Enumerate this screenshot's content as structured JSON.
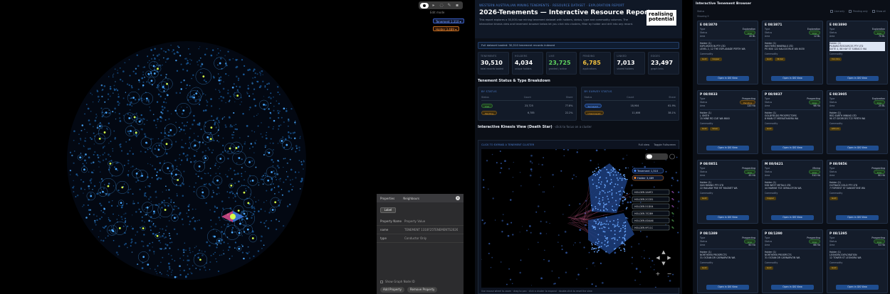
{
  "graph_view": {
    "toolbar_icons": [
      "grab-icon",
      "pointer-icon",
      "lasso-icon",
      "pen-icon",
      "trash-icon"
    ],
    "caption": "Edit mode",
    "tags": [
      "Tenement 1,310 ▾",
      "Holder 3,489 ▾"
    ],
    "properties": {
      "tab1": "Properties",
      "tab2": "Neighbours",
      "label_button": "Label",
      "col_name": "Property Name",
      "col_value": "Property Value",
      "rows": [
        {
          "key": "name",
          "value": "TENEMENT 1310F25TENEMENTS2026"
        },
        {
          "key": "type",
          "value": "Conductor Only"
        }
      ],
      "show_graph_nodes": "Show Graph Node ID",
      "add_property": "Add Property",
      "remove_property": "Remove Property"
    },
    "colors": {
      "node": "#1a5a9a",
      "hub": "#4aa8ff",
      "accent": "#d6ff4a"
    }
  },
  "report": {
    "eyebrow": "WESTERN AUSTRALIAN MINING TENEMENTS · RESOURCE DATASET · EXPLORATION REPORT",
    "title": "2026-Tenements — Interactive Resource Report",
    "description": "This report explores a 30,000-row mining tenement dataset with holders, status, type and commodity columns. The interactive kinesis view and tenement browser below let you click into clusters, filter by holder and drill into any record.",
    "logo_line1": "realising",
    "logo_line2": "potential",
    "banner": "Full dataset loaded: 30,510 tenement records indexed",
    "stats": [
      {
        "label": "TENEMENTS",
        "value": "30,510",
        "sub": "total records loaded",
        "color": "#ffffff"
      },
      {
        "label": "HOLDERS",
        "value": "4,034",
        "sub": "unique holders",
        "color": "#ffffff"
      },
      {
        "label": "LIVE",
        "value": "23,725",
        "sub": "granted / active",
        "color": "#5fd35f"
      },
      {
        "label": "PENDING",
        "value": "6,785",
        "sub": "applications",
        "color": "#f0c040"
      },
      {
        "label": "LINKED",
        "value": "7,013",
        "sub": "shared holders",
        "color": "#ffffff"
      },
      {
        "label": "EDGES",
        "value": "23,497",
        "sub": "graph links",
        "color": "#ffffff"
      }
    ],
    "breakdown_title": "Tenement Status & Type Breakdown",
    "status_card": {
      "title": "BY STATUS",
      "cols": [
        "Status",
        "Count",
        "Share"
      ],
      "rows": [
        {
          "chip": "Live",
          "chip_kind": "g",
          "count": "23,725",
          "share": "77.8%"
        },
        {
          "chip": "Pending",
          "chip_kind": "o",
          "count": "6,785",
          "share": "22.2%"
        }
      ]
    },
    "type_card": {
      "title": "BY SURVEY STATUS",
      "cols": [
        "Status",
        "Count",
        "Share"
      ],
      "rows": [
        {
          "chip": "Surveyed",
          "chip_kind": "b",
          "count": "18,904",
          "share": "61.9%"
        },
        {
          "chip": "Unsurveyed",
          "chip_kind": "o",
          "count": "11,606",
          "share": "38.1%"
        }
      ]
    },
    "kinesis_title": "Interactive Kinesis View (Death Star)",
    "kinesis_note": "· click to focus on a cluster",
    "kinesis_header": "CLICK TO EXPAND A TENEMENT CLUSTER",
    "kinesis_btn1": "Full view",
    "kinesis_btn2": "Toggle Fullscreen",
    "kinesis_legend": [
      {
        "label": "Tenement 1,310",
        "color": "#4a8cff"
      },
      {
        "label": "Holder 3,489",
        "color": "#ff8c2a"
      }
    ],
    "kinesis_items": [
      "HOLDER-3A9F2",
      "HOLDER-2CC81",
      "HOLDER-51D04",
      "HOLDER-7E2B9",
      "HOLDER-0D4A6",
      "HOLDER-9F11C"
    ],
    "kinesis_footer": "Use mouse wheel to zoom · drag to pan · click a cluster to expand · double-click to reset the view"
  },
  "browser": {
    "title": "Interactive Tenement Browser",
    "filter_label": "Status",
    "filter_opts": [
      "Live only",
      "Pending only",
      "Show all"
    ],
    "count": "Showing 9",
    "labels": {
      "type": "Type",
      "status": "Status",
      "area": "Area",
      "holder": "Holders",
      "tags": "Commodity",
      "button": "Open in GIS View"
    },
    "cards": [
      {
        "id": "E 08/3870",
        "type": "Exploration",
        "status": "Live",
        "area": "40 BL",
        "holder": "Holder (1)\nEXPLORATION PTY LTD\nLEVEL 2, 12 THE ESPLANADE PERTH WA",
        "tags": [
          "Gold",
          "Copper"
        ],
        "hl": false
      },
      {
        "id": "E 08/3871",
        "type": "Exploration",
        "status": "Live",
        "area": "12 BL",
        "holder": "Holder (1)\nWESTERN MINERALS LTD\nPO BOX 122 KALGOORLIE WA 6430",
        "tags": [
          "Gold",
          "Nickel"
        ],
        "hl": false
      },
      {
        "id": "E 08/3890",
        "type": "Exploration",
        "status": "Live",
        "area": "70 BL",
        "holder": "Holder (2)\nPILBARA RESOURCES PTY LTD\nSUITE 4, 88 HAY ST SUBIACO WA",
        "tags": [
          "Iron Ore"
        ],
        "hl": true
      },
      {
        "id": "P 08/0833",
        "type": "Prospecting",
        "status": "Pending",
        "area": "120 HA",
        "holder": "Holder (1)\nJ. SMITH\n15 MINE RD CUE WA 6640",
        "tags": [
          "Gold",
          "Silver"
        ],
        "hl": false
      },
      {
        "id": "P 08/0837",
        "type": "Prospecting",
        "status": "Live",
        "area": "98 HA",
        "holder": "Holder (1)\nGOLDFIELDS PROSPECTORS\n8 MAIN ST MEEKATHARRA WA",
        "tags": [
          "Gold"
        ],
        "hl": false
      },
      {
        "id": "E 08/3905",
        "type": "Exploration",
        "status": "Live",
        "area": "25 BL",
        "holder": "Holder (1)\nRED EARTH MINING LTD\n90 ST GEORGES TCE PERTH WA",
        "tags": [
          "Lithium"
        ],
        "hl": false
      },
      {
        "id": "P 08/0851",
        "type": "Prospecting",
        "status": "Live",
        "area": "45 HA",
        "holder": "Holder (1)\nSUN MINING PTY LTD\n22 RAILWAY PDE MT MAGNET WA",
        "tags": [
          "Gold"
        ],
        "hl": false
      },
      {
        "id": "M 08/0421",
        "type": "Mining",
        "status": "Live",
        "area": "310 HA",
        "holder": "Holder (1)\nMID WEST METALS LTD\n44 MARINE TCE GERALDTON WA",
        "tags": [
          "Copper"
        ],
        "hl": false
      },
      {
        "id": "P 08/0856",
        "type": "Prospecting",
        "status": "Live",
        "area": "80 HA",
        "holder": "Holder (1)\nOUTBACK GOLD PTY LTD\n7 FORREST ST SANDSTONE WA",
        "tags": [
          "Gold"
        ],
        "hl": false
      },
      {
        "id": "P 08/1389",
        "type": "Prospecting",
        "status": "Live",
        "area": "60 HA",
        "holder": "Holder (1)\nNORTHERN PROSPECTS\n31 OCEAN DR CARNARVON WA",
        "tags": [
          "Gold"
        ],
        "hl": false
      },
      {
        "id": "P 08/1390",
        "type": "Prospecting",
        "status": "Live",
        "area": "66 HA",
        "holder": "Holder (1)\nNORTHERN PROSPECTS\n31 OCEAN DR CARNARVON WA",
        "tags": [
          "Gold"
        ],
        "hl": false
      },
      {
        "id": "P 08/1395",
        "type": "Prospecting",
        "status": "Live",
        "area": "52 HA",
        "holder": "Holder (1)\nLEONORA EXPLORATION\n12 TOWER ST LEONORA WA",
        "tags": [
          "Gold"
        ],
        "hl": false
      }
    ]
  }
}
